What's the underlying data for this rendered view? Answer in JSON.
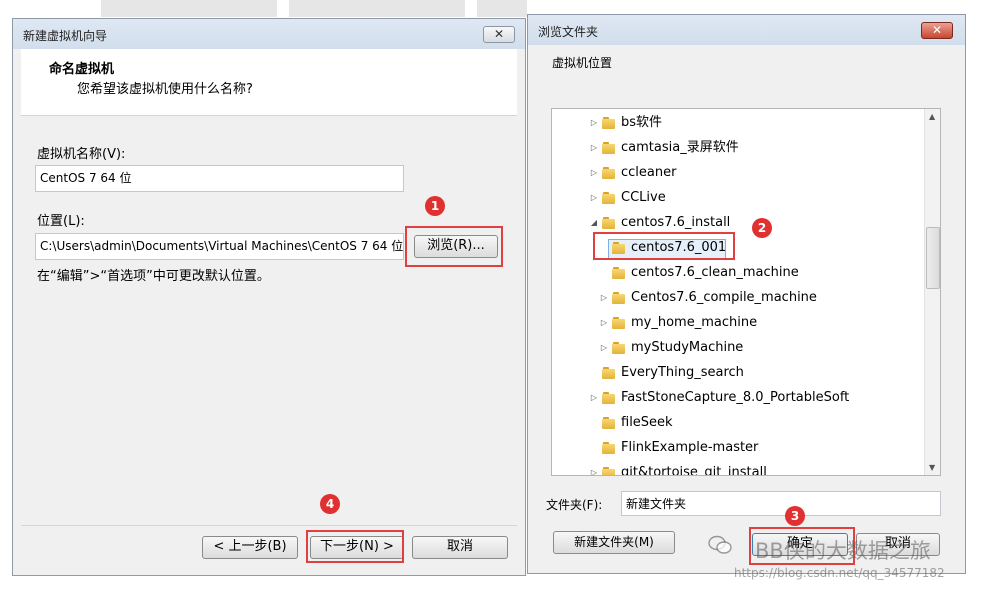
{
  "wizard": {
    "title": "新建虚拟机向导",
    "close_label": "✕",
    "header_title": "命名虚拟机",
    "header_subtitle": "您希望该虚拟机使用什么名称?",
    "name_label": "虚拟机名称(V):",
    "name_value": "CentOS 7 64 位",
    "location_label": "位置(L):",
    "location_value": "C:\\Users\\admin\\Documents\\Virtual Machines\\CentOS 7 64 位",
    "browse_label": "浏览(R)...",
    "hint": "在“编辑”>“首选项”中可更改默认位置。",
    "back_label": "< 上一步(B)",
    "next_label": "下一步(N) >",
    "cancel_label": "取消"
  },
  "browse_dialog": {
    "title": "浏览文件夹",
    "close_label": "✕",
    "subtitle": "虚拟机位置",
    "tree_items": [
      {
        "label": "bs软件",
        "level": 1,
        "expander": "right"
      },
      {
        "label": "camtasia_录屏软件",
        "level": 1,
        "expander": "right"
      },
      {
        "label": "ccleaner",
        "level": 1,
        "expander": "right"
      },
      {
        "label": "CCLive",
        "level": 1,
        "expander": "right"
      },
      {
        "label": "centos7.6_install",
        "level": 1,
        "expander": "down"
      },
      {
        "label": "centos7.6_001",
        "level": 2,
        "expander": "none",
        "selected": true
      },
      {
        "label": "centos7.6_clean_machine",
        "level": 2,
        "expander": "none"
      },
      {
        "label": "Centos7.6_compile_machine",
        "level": 2,
        "expander": "right"
      },
      {
        "label": "my_home_machine",
        "level": 2,
        "expander": "right"
      },
      {
        "label": "myStudyMachine",
        "level": 2,
        "expander": "right"
      },
      {
        "label": "EveryThing_search",
        "level": 1,
        "expander": "none"
      },
      {
        "label": "FastStoneCapture_8.0_PortableSoft",
        "level": 1,
        "expander": "right"
      },
      {
        "label": "fileSeek",
        "level": 1,
        "expander": "none"
      },
      {
        "label": "FlinkExample-master",
        "level": 1,
        "expander": "none"
      },
      {
        "label": "git&tortoise_git_install",
        "level": 1,
        "expander": "right"
      }
    ],
    "folder_label": "文件夹(F):",
    "folder_value": "新建文件夹",
    "new_folder_label": "新建文件夹(M)",
    "ok_label": "确定",
    "cancel_label": "取消"
  },
  "annotations": {
    "badge_1": "1",
    "badge_2": "2",
    "badge_3": "3",
    "badge_4": "4",
    "color": "#e03030"
  },
  "watermark": {
    "brand": "BB侠的大数据之旅",
    "url": "https://blog.csdn.net/qq_34577182"
  }
}
